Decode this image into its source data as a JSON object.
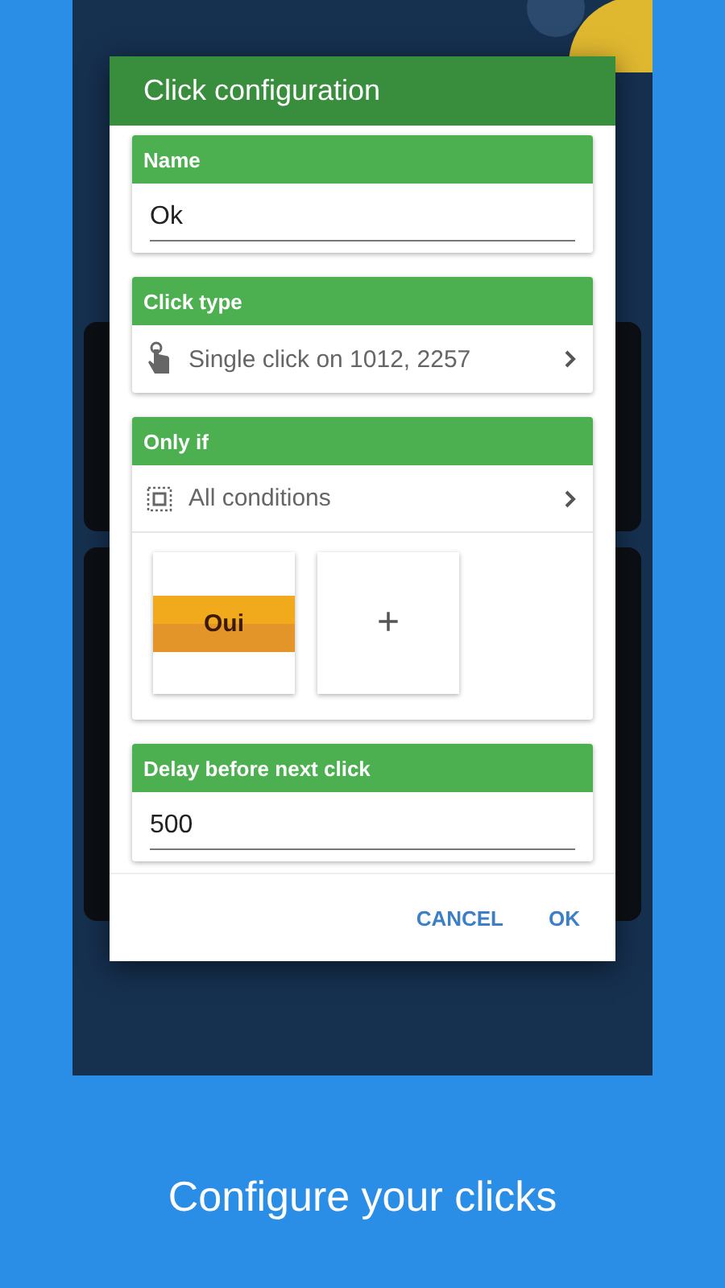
{
  "dialog": {
    "title": "Click configuration",
    "sections": [
      {
        "kind": "input",
        "label": "Name",
        "value": "Ok"
      },
      {
        "kind": "click_type",
        "label": "Click type",
        "value": "Single click on 1012, 2257"
      },
      {
        "kind": "conditions",
        "label": "Only if",
        "operator": "All conditions",
        "conditions": [
          {
            "label": "Oui"
          }
        ],
        "add_label": "+"
      },
      {
        "kind": "input",
        "label": "Delay before next click",
        "value": "500"
      }
    ],
    "buttons": [
      {
        "label": "CANCEL"
      },
      {
        "label": "OK"
      }
    ]
  },
  "caption": "Configure your clicks"
}
